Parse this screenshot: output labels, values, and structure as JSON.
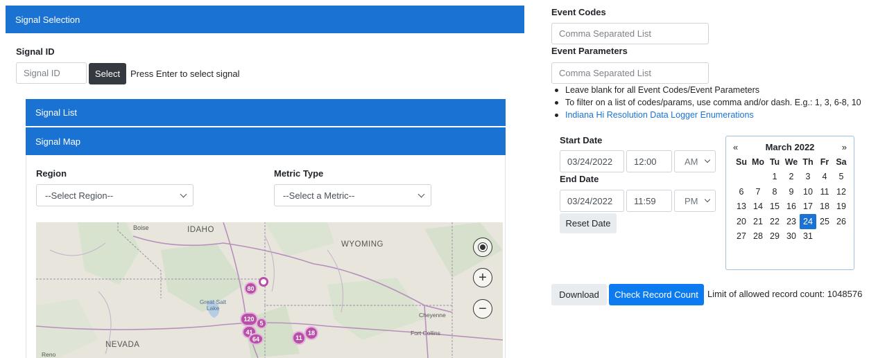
{
  "signal_selection": {
    "header": "Signal Selection",
    "signal_id_label": "Signal ID",
    "signal_id_placeholder": "Signal ID",
    "select_button": "Select",
    "hint": "Press Enter to select signal"
  },
  "signal_list": {
    "header": "Signal List"
  },
  "signal_map": {
    "header": "Signal Map",
    "region_label": "Region",
    "region_value": "--Select Region--",
    "metric_label": "Metric Type",
    "metric_value": "--Select a Metric--",
    "map_labels": {
      "idaho": "IDAHO",
      "wyoming": "WYOMING",
      "nevada": "NEVADA",
      "boise": "Boise",
      "great_salt_lake": "Great Salt Lake",
      "cheyenne": "Cheyenne",
      "fort_collins": "Fort Collins",
      "reno": "Reno"
    },
    "clusters": [
      "80",
      "120",
      "5",
      "41",
      "64",
      "11",
      "18"
    ],
    "controls": {
      "locate_icon": "locate-icon",
      "zoom_in_icon": "plus-circle-icon",
      "zoom_out_icon": "minus-circle-icon"
    }
  },
  "event_codes": {
    "label": "Event Codes",
    "placeholder": "Comma Separated List"
  },
  "event_parameters": {
    "label": "Event Parameters",
    "placeholder": "Comma Separated List"
  },
  "notes": [
    "Leave blank for all Event Codes/Event Parameters",
    "To filter on a list of codes/params, use comma and/or dash. E.g.: 1, 3, 6-8, 10",
    "Indiana Hi Resolution Data Logger Enumerations"
  ],
  "start_date": {
    "label": "Start Date",
    "date": "03/24/2022",
    "time": "12:00",
    "ampm": "AM"
  },
  "end_date": {
    "label": "End Date",
    "date": "03/24/2022",
    "time": "11:59",
    "ampm": "PM"
  },
  "reset_button": "Reset Date",
  "calendar": {
    "prev": "«",
    "next": "»",
    "title": "March 2022",
    "dow": [
      "Su",
      "Mo",
      "Tu",
      "We",
      "Th",
      "Fr",
      "Sa"
    ],
    "weeks": [
      [
        "",
        "",
        "1",
        "2",
        "3",
        "4",
        "5"
      ],
      [
        "6",
        "7",
        "8",
        "9",
        "10",
        "11",
        "12"
      ],
      [
        "13",
        "14",
        "15",
        "16",
        "17",
        "18",
        "19"
      ],
      [
        "20",
        "21",
        "22",
        "23",
        "24",
        "25",
        "26"
      ],
      [
        "27",
        "28",
        "29",
        "30",
        "31",
        "",
        ""
      ]
    ],
    "selected": "24"
  },
  "download_button": "Download",
  "check_button": "Check Record Count",
  "limit_text": "Limit of allowed record count: 1048576",
  "colors": {
    "primary": "#1a73d2",
    "button_blue": "#0d7bf0",
    "dark": "#343a40",
    "cluster": "#b84fa6"
  }
}
